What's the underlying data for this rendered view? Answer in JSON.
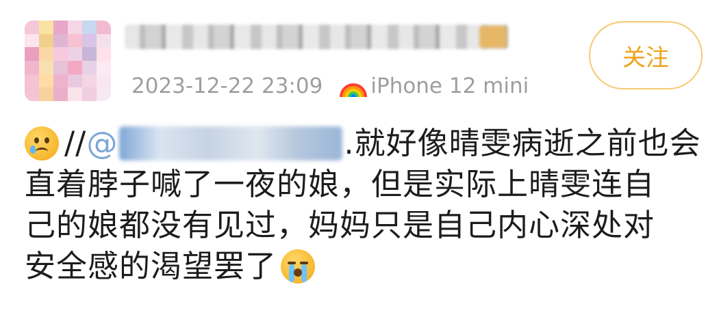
{
  "post": {
    "avatar_colors": [
      "#f4c7d9",
      "#f8e3a2",
      "#e8a6c8",
      "#f6d6e6",
      "#c7d8f0",
      "#f2b9cf",
      "#fde4ef",
      "#f1cf8d",
      "#e0b4d4",
      "#f7c1d2",
      "#d9c3e6",
      "#f3e0ea",
      "#e9a0bf",
      "#fbd7a7",
      "#f6c9de",
      "#edd2e6",
      "#c8b6d8",
      "#ffe1eb",
      "#f0b6cc",
      "#f9e0b2",
      "#e7c2d8",
      "#f3a9c4",
      "#e6d1e7",
      "#fbeaf1",
      "#f6c3d5",
      "#ffdca5",
      "#efb3cc",
      "#e9c9df",
      "#f5d6e4",
      "#f8e7ef",
      "#f2c4d6",
      "#f6d29e",
      "#eab0c9",
      "#fbe3ec",
      "#f0cde0",
      "#f7e9f1"
    ],
    "timestamp": "2023-12-22 23:09",
    "device": "iPhone 12 mini",
    "follow_label": "关注",
    "line1_slashes": "//",
    "line1_at": "@",
    "line1_text": ".就好像晴雯病逝之前也会",
    "line2": "直着脖子喊了一夜的娘，但是实际上晴雯连自",
    "line3": "己的娘都没有见过，妈妈只是自己内心深处对",
    "line4": "安全感的渴望罢了",
    "accent_color": "#f0a21c"
  }
}
